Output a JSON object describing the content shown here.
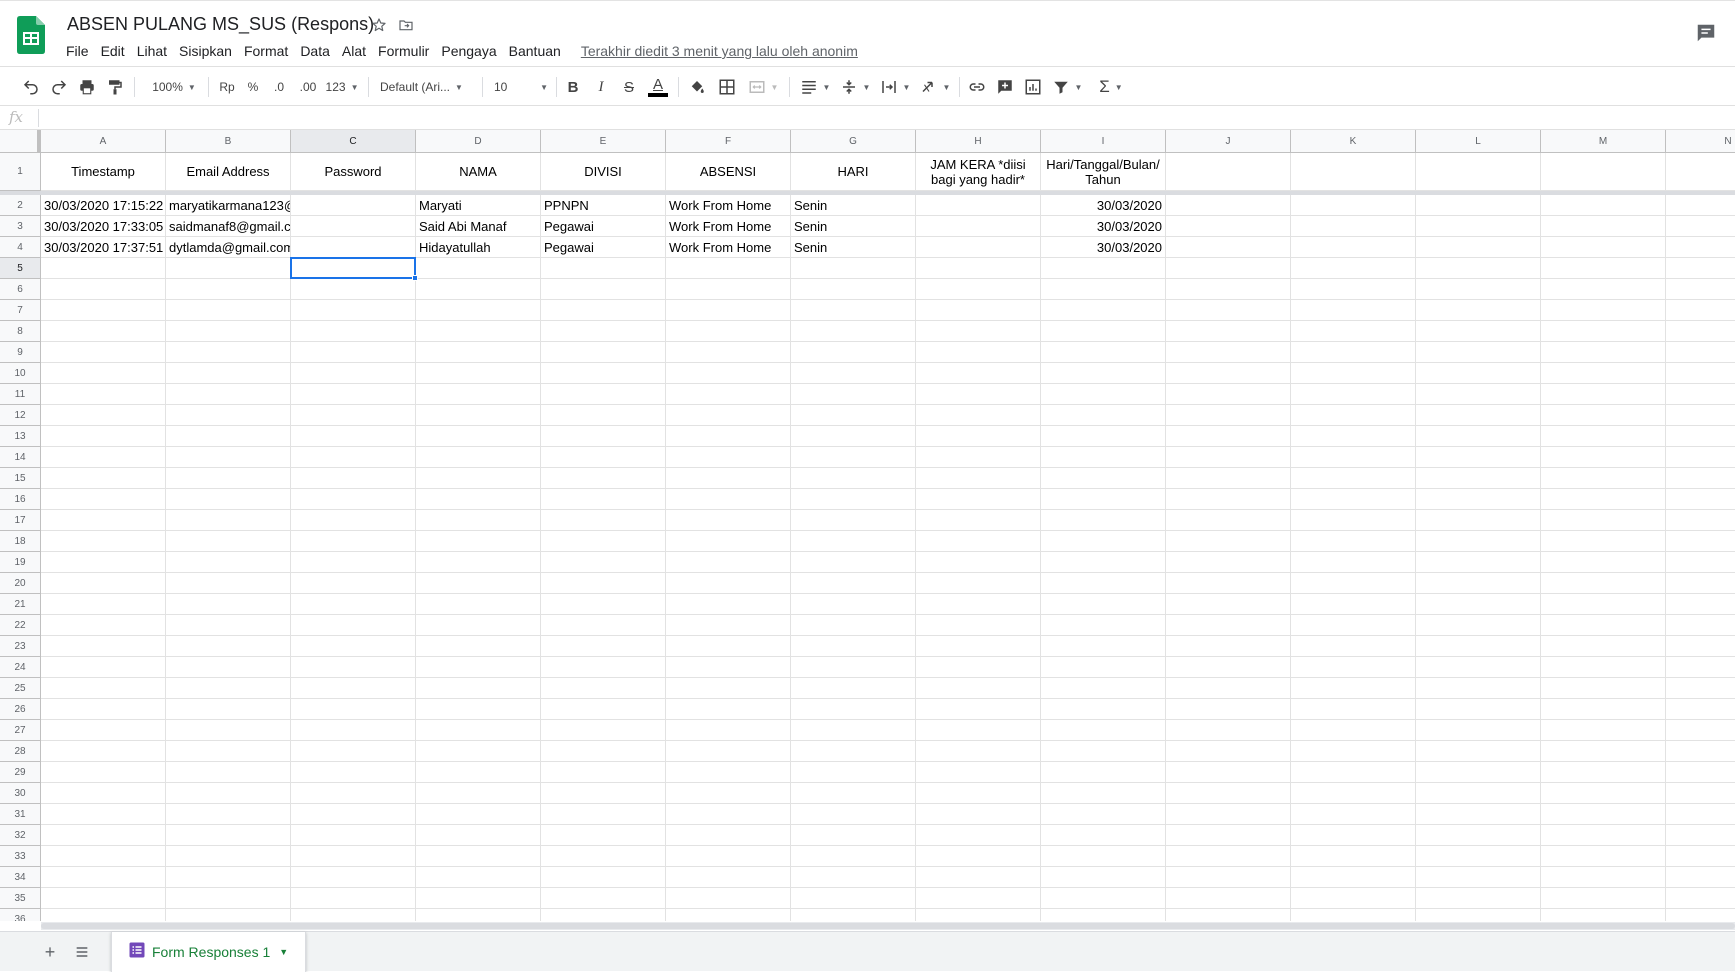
{
  "app": {
    "title": "ABSEN PULANG MS_SUS (Respons)",
    "brand_color": "#0f9d58",
    "icons": {
      "logo": "google-sheets-icon",
      "star": "star-icon",
      "move": "folder-move-icon",
      "comments": "comments-icon"
    }
  },
  "menu": {
    "items": [
      "File",
      "Edit",
      "Lihat",
      "Sisipkan",
      "Format",
      "Data",
      "Alat",
      "Formulir",
      "Pengaya",
      "Bantuan"
    ],
    "last_edit": "Terakhir diedit 3 menit yang lalu oleh anonim"
  },
  "toolbar": {
    "zoom": "100%",
    "currency": "Rp",
    "percent": "%",
    "decimal_decrease": ".0",
    "decimal_increase": ".00",
    "number_format": "123",
    "font": "Default (Ari...",
    "font_size": "10",
    "text_color": "#000000"
  },
  "formula_bar": {
    "fx": "fx",
    "value": ""
  },
  "grid": {
    "columns": [
      "A",
      "B",
      "C",
      "D",
      "E",
      "F",
      "G",
      "H",
      "I",
      "J",
      "K",
      "L",
      "M",
      "N"
    ],
    "selected_column": "C",
    "selected_row": 5,
    "row_count": 36,
    "header_row": [
      "Timestamp",
      "Email Address",
      "Password",
      "NAMA",
      "DIVISI",
      "ABSENSI",
      "HARI",
      "JAM KERA   *diisi bagi yang hadir*",
      "Hari/Tanggal/Bulan/ Tahun"
    ],
    "rows": [
      [
        "30/03/2020 17:15:22",
        "maryatikarmana123@",
        "",
        "Maryati",
        "PPNPN",
        "Work From Home",
        "Senin",
        "",
        "30/03/2020"
      ],
      [
        "30/03/2020 17:33:05",
        "saidmanaf8@gmail.c",
        "",
        "Said Abi Manaf",
        "Pegawai",
        "Work From Home",
        "Senin",
        "",
        "30/03/2020"
      ],
      [
        "30/03/2020 17:37:51",
        "dytlamda@gmail.com",
        "",
        "Hidayatullah",
        "Pegawai",
        "Work From Home",
        "Senin",
        "",
        "30/03/2020"
      ]
    ],
    "selection_color": "#1a73e8"
  },
  "sheets": {
    "tabs": [
      {
        "label": "Form Responses 1",
        "icon": "form-icon",
        "active": true
      }
    ],
    "add_icon": "plus-icon",
    "list_icon": "sheet-list-icon",
    "tab_color": "#188038"
  }
}
